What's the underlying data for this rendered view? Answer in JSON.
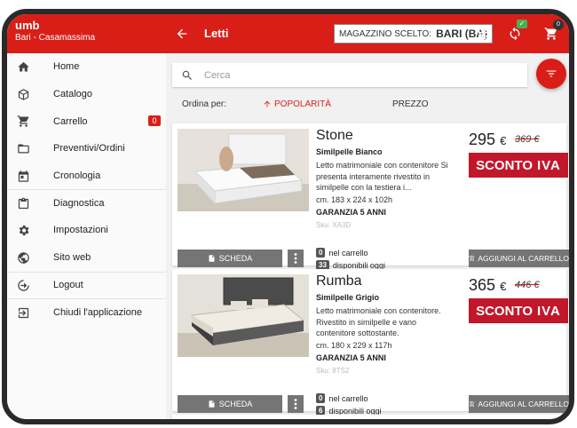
{
  "user": {
    "name": "umb",
    "location": "Bari - Casamassima"
  },
  "sidebar": {
    "items": [
      {
        "label": "Home",
        "icon": "home-icon"
      },
      {
        "label": "Catalogo",
        "icon": "box-icon"
      },
      {
        "label": "Carrello",
        "icon": "cart-icon",
        "badge": "0"
      },
      {
        "label": "Preventivi/Ordini",
        "icon": "folder-icon"
      },
      {
        "label": "Cronologia",
        "icon": "calendar-icon"
      },
      {
        "label": "Diagnostica",
        "icon": "clipboard-icon"
      },
      {
        "label": "Impostazioni",
        "icon": "gear-icon"
      },
      {
        "label": "Sito web",
        "icon": "globe-icon"
      },
      {
        "label": "Logout",
        "icon": "logout-icon"
      },
      {
        "label": "Chiudi l'applicazione",
        "icon": "exit-icon"
      }
    ]
  },
  "header": {
    "title": "Letti",
    "warehouse_label": "MAGAZZINO SCELTO:",
    "warehouse_value": "BARI (BA)",
    "sync_badge": "✓",
    "cart_count": "0"
  },
  "search": {
    "placeholder": "Cerca"
  },
  "sort": {
    "label": "Ordina per:",
    "popularity": "POPOLARITÀ",
    "price": "PREZZO"
  },
  "buttons": {
    "scheda": "SCHEDA",
    "add_to_cart": "AGGIUNGI AL CARRELLO"
  },
  "badge": {
    "sconto": "SCONTO",
    "iva": "IVA"
  },
  "stock_labels": {
    "cart": "nel carrello",
    "available": "disponibili oggi"
  },
  "products": [
    {
      "name": "Stone",
      "variant": "Similpelle Bianco",
      "description": "Letto matrimoniale con contenitore Si presenta interamente rivestito in similpelle con la testiera i...",
      "dimensions": "cm. 183 x 224 x 102h",
      "warranty": "GARANZIA 5 ANNI",
      "sku": "Sku: XA3D",
      "price": "295",
      "currency": "€",
      "old_price": "369 €",
      "in_cart": "0",
      "available": "33",
      "color": "#ffffff"
    },
    {
      "name": "Rumba",
      "variant": "Similpelle Grigio",
      "description": "Letto matrimoniale con contenitore. Rivestito in similpelle e vano contenitore sottostante.",
      "dimensions": "cm. 180 x 229 x 117h",
      "warranty": "GARANZIA 5 ANNI",
      "sku": "Sku: 8TS2",
      "price": "365",
      "currency": "€",
      "old_price": "446 €",
      "in_cart": "0",
      "available": "6",
      "color": "#4a4a4a"
    }
  ],
  "colors": {
    "accent": "#d91e18",
    "sconto_bg": "#c2172a",
    "button_bg": "#757575"
  }
}
